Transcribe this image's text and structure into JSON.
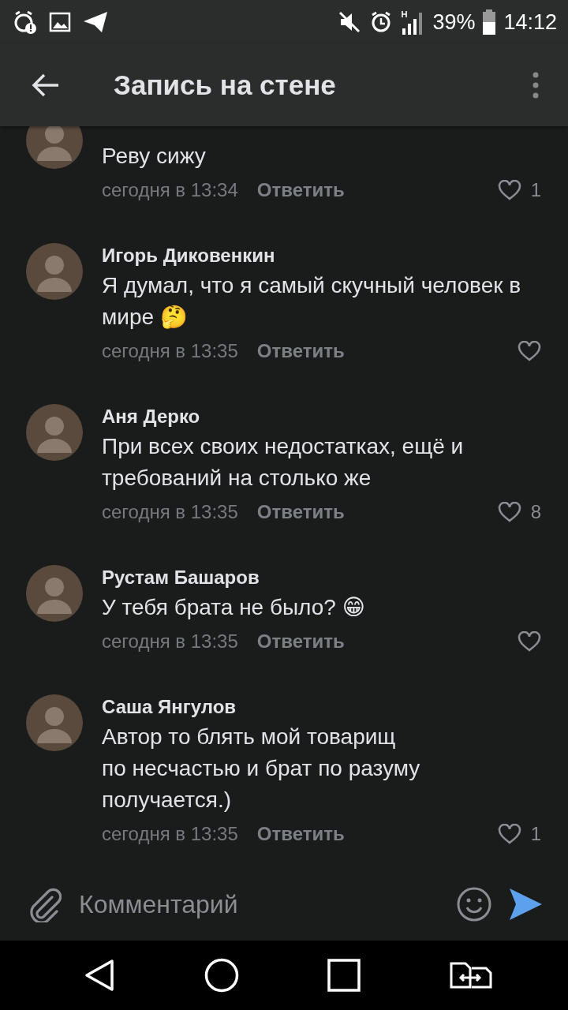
{
  "status_bar": {
    "battery": "39%",
    "time": "14:12"
  },
  "header": {
    "title": "Запись на стене"
  },
  "comments": [
    {
      "text": "Реву сижу",
      "time": "сегодня в 13:34",
      "reply": "Ответить",
      "likes": "1"
    },
    {
      "author": "Игорь Диковенкин",
      "text": "Я думал, что я самый скучный человек в мире 🤔",
      "time": "сегодня в 13:35",
      "reply": "Ответить"
    },
    {
      "author": "Аня Дерко",
      "text": "При всех своих недостатках, ещё и требований на столько же",
      "time": "сегодня в 13:35",
      "reply": "Ответить",
      "likes": "8"
    },
    {
      "author": "Рустам Башаров",
      "text": "У тебя брата не было? 😁",
      "time": "сегодня в 13:35",
      "reply": "Ответить"
    },
    {
      "author": "Саша Янгулов",
      "text": "Автор то блять мой товарищ\nпо несчастью и брат по разуму\nполучается.)",
      "time": "сегодня в 13:35",
      "reply": "Ответить",
      "likes": "1"
    }
  ],
  "composer": {
    "placeholder": "Комментарий"
  }
}
